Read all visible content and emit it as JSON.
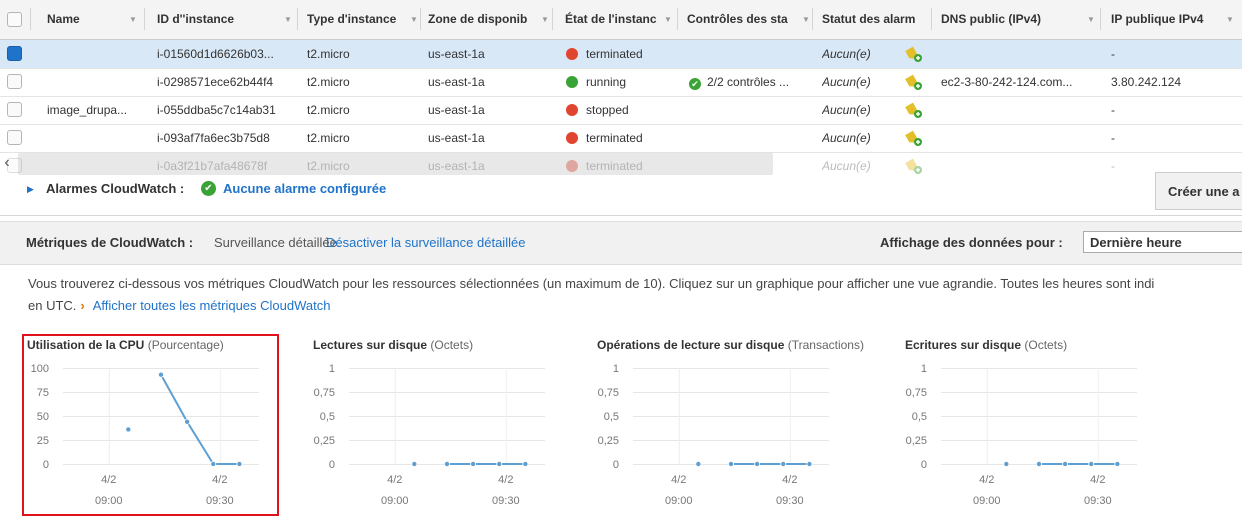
{
  "table": {
    "columns": [
      "Name",
      "ID d''instance",
      "Type d'instance",
      "Zone de disponib",
      "État de l'instanc",
      "Contrôles des sta",
      "Statut des alarm",
      "DNS public (IPv4)",
      "IP publique IPv4"
    ],
    "rows": [
      {
        "name": "",
        "id": "i-01560d1d6626b03...",
        "type": "t2.micro",
        "zone": "us-east-1a",
        "state": "terminated",
        "state_color": "#e2452f",
        "checks": "",
        "alarm": "Aucun(e)",
        "dns": "",
        "ip": "-",
        "selected": true
      },
      {
        "name": "",
        "id": "i-0298571ece62b44f4",
        "type": "t2.micro",
        "zone": "us-east-1a",
        "state": "running",
        "state_color": "#3aa335",
        "checks": "2/2 contrôles ...",
        "alarm": "Aucun(e)",
        "dns": "ec2-3-80-242-124.com...",
        "ip": "3.80.242.124",
        "selected": false
      },
      {
        "name": "image_drupa...",
        "id": "i-055ddba5c7c14ab31",
        "type": "t2.micro",
        "zone": "us-east-1a",
        "state": "stopped",
        "state_color": "#e2452f",
        "checks": "",
        "alarm": "Aucun(e)",
        "dns": "",
        "ip": "-",
        "selected": false
      },
      {
        "name": "",
        "id": "i-093af7fa6ec3b75d8",
        "type": "t2.micro",
        "zone": "us-east-1a",
        "state": "terminated",
        "state_color": "#e2452f",
        "checks": "",
        "alarm": "Aucun(e)",
        "dns": "",
        "ip": "-",
        "selected": false
      },
      {
        "name": "",
        "id": "i-0a3f21b7afa48678f",
        "type": "t2.micro",
        "zone": "us-east-1a",
        "state": "terminated",
        "state_color": "#e2452f",
        "checks": "",
        "alarm": "Aucun(e)",
        "dns": "",
        "ip": "-",
        "selected": false
      }
    ]
  },
  "alarms": {
    "label": "Alarmes CloudWatch :",
    "status": "Aucune alarme configurée",
    "create_button": "Créer une a"
  },
  "metrics_bar": {
    "title": "Métriques de CloudWatch :",
    "monitoring": "Surveillance détaillée.",
    "disable_link": "Désactiver la surveillance détaillée",
    "range_label": "Affichage des données pour :",
    "range_value": "Dernière heure"
  },
  "description": {
    "line1": "Vous trouverez ci-dessous vos métriques CloudWatch pour les ressources sélectionnées (un maximum de 10). Cliquez sur un graphique pour afficher une vue agrandie. Toutes les heures sont indi",
    "line2_prefix": "en UTC.",
    "link": "Afficher toutes les métriques CloudWatch"
  },
  "chart_data": [
    {
      "type": "line",
      "title": "Utilisation de la CPU",
      "unit": "(Pourcentage)",
      "yticks": [
        "100",
        "75",
        "50",
        "25",
        "0"
      ],
      "ylim": [
        0,
        100
      ],
      "xticks": [
        {
          "date": "4/2",
          "time": "09:00"
        },
        {
          "date": "4/2",
          "time": "09:30"
        }
      ],
      "points": [
        {
          "t": 10,
          "y": 36,
          "isolated": true
        },
        {
          "t": 15,
          "y": 93
        },
        {
          "t": 19,
          "y": 44
        },
        {
          "t": 23,
          "y": 0
        },
        {
          "t": 27,
          "y": 0
        }
      ],
      "highlighted": true
    },
    {
      "type": "line",
      "title": "Lectures sur disque",
      "unit": "(Octets)",
      "yticks": [
        "1",
        "0,75",
        "0,5",
        "0,25",
        "0"
      ],
      "ylim": [
        0,
        1
      ],
      "xticks": [
        {
          "date": "4/2",
          "time": "09:00"
        },
        {
          "date": "4/2",
          "time": "09:30"
        }
      ],
      "points": [
        {
          "t": 10,
          "y": 0,
          "isolated": true
        },
        {
          "t": 15,
          "y": 0
        },
        {
          "t": 19,
          "y": 0
        },
        {
          "t": 23,
          "y": 0
        },
        {
          "t": 27,
          "y": 0
        }
      ],
      "highlighted": false
    },
    {
      "type": "line",
      "title": "Opérations de lecture sur disque",
      "unit": "(Transactions)",
      "yticks": [
        "1",
        "0,75",
        "0,5",
        "0,25",
        "0"
      ],
      "ylim": [
        0,
        1
      ],
      "xticks": [
        {
          "date": "4/2",
          "time": "09:00"
        },
        {
          "date": "4/2",
          "time": "09:30"
        }
      ],
      "points": [
        {
          "t": 10,
          "y": 0,
          "isolated": true
        },
        {
          "t": 15,
          "y": 0
        },
        {
          "t": 19,
          "y": 0
        },
        {
          "t": 23,
          "y": 0
        },
        {
          "t": 27,
          "y": 0
        }
      ],
      "highlighted": false
    },
    {
      "type": "line",
      "title": "Ecritures sur disque",
      "unit": "(Octets)",
      "yticks": [
        "1",
        "0,75",
        "0,5",
        "0,25",
        "0"
      ],
      "ylim": [
        0,
        1
      ],
      "xticks": [
        {
          "date": "4/2",
          "time": "09:00"
        },
        {
          "date": "4/2",
          "time": "09:30"
        }
      ],
      "points": [
        {
          "t": 10,
          "y": 0,
          "isolated": true
        },
        {
          "t": 15,
          "y": 0
        },
        {
          "t": 19,
          "y": 0
        },
        {
          "t": 23,
          "y": 0
        },
        {
          "t": 27,
          "y": 0
        }
      ],
      "highlighted": false
    }
  ],
  "colors": {
    "accent": "#1f73c9",
    "series": "#5d9fd3",
    "highlight": "#e0121b"
  }
}
